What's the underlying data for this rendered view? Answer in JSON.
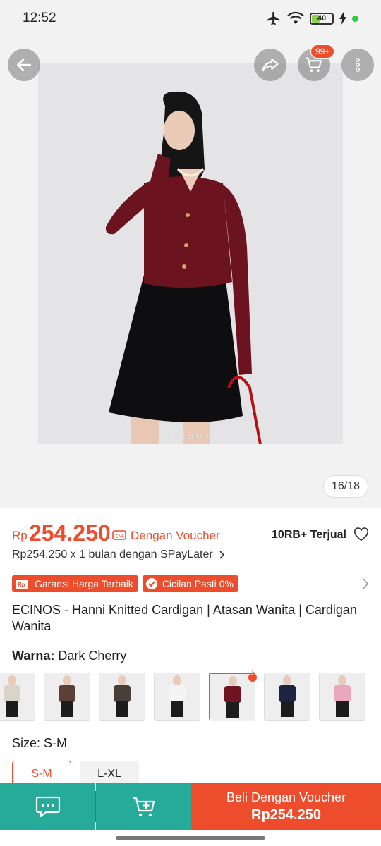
{
  "status_bar": {
    "time": "12:52",
    "battery": "40",
    "battery_level": 0.4
  },
  "gallery": {
    "counter": "16/18",
    "cart_badge": "99+",
    "brand_watermark": "ecinos"
  },
  "product": {
    "currency": "Rp",
    "price": "254.250",
    "voucher_text": "Dengan Voucher",
    "sold": "10RB+ Terjual",
    "paylater": "Rp254.250 x 1 bulan dengan SPayLater",
    "badges": [
      "Garansi Harga Terbaik",
      "Cicilan Pasti 0%"
    ],
    "title": "ECINOS - Hanni Knitted Cardigan | Atasan Wanita | Cardigan Wanita"
  },
  "variant": {
    "label": "Warna:",
    "value": "Dark Cherry",
    "thumbnail_colors": [
      "#d9d3c8",
      "#5a4036",
      "#4a3f38",
      "#f4f4f4",
      "#6e1422",
      "#1e2440",
      "#e9a8bd"
    ],
    "selected_index": 4
  },
  "size": {
    "label": "Size:",
    "value": "S-M",
    "options": [
      "S-M",
      "L-XL"
    ],
    "selected_index": 0
  },
  "bottom_bar": {
    "buy_label": "Beli Dengan Voucher",
    "buy_price": "Rp254.250"
  },
  "colors": {
    "accent": "#ee4d2d",
    "teal": "#26aa99"
  }
}
